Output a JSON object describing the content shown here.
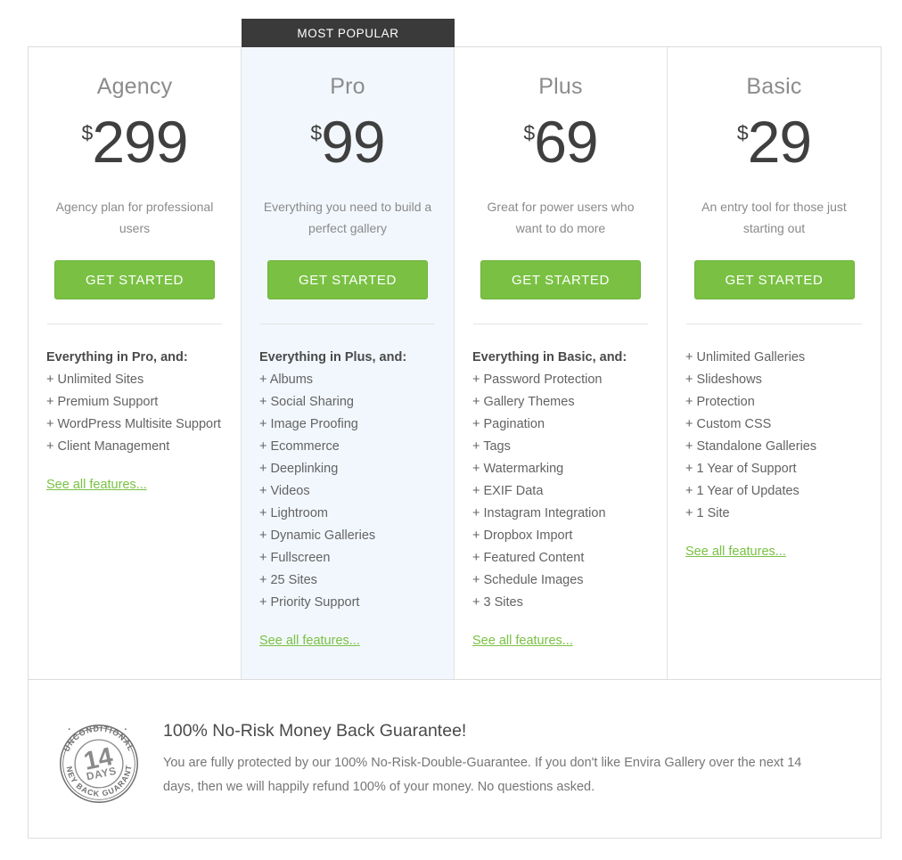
{
  "badge": {
    "label": "MOST POPULAR"
  },
  "colors": {
    "accent_green": "#7ac143",
    "featured_bg": "#f2f7fd",
    "ribbon_bg": "#3a3a3a"
  },
  "plans": [
    {
      "name": "Agency",
      "currency": "$",
      "price": "299",
      "tagline": "Agency plan for professional users",
      "cta": "GET STARTED",
      "features_head": "Everything in Pro, and:",
      "features": [
        "+ Unlimited Sites",
        "+ Premium Support",
        "+ WordPress Multisite Support",
        "+ Client Management"
      ],
      "see_all": "See all features...",
      "featured": false
    },
    {
      "name": "Pro",
      "currency": "$",
      "price": "99",
      "tagline": "Everything you need to build a perfect gallery",
      "cta": "GET STARTED",
      "features_head": "Everything in Plus, and:",
      "features": [
        "+ Albums",
        "+ Social Sharing",
        "+ Image Proofing",
        "+ Ecommerce",
        "+ Deeplinking",
        "+ Videos",
        "+ Lightroom",
        "+ Dynamic Galleries",
        "+ Fullscreen",
        "+ 25 Sites",
        "+ Priority Support"
      ],
      "see_all": "See all features...",
      "featured": true
    },
    {
      "name": "Plus",
      "currency": "$",
      "price": "69",
      "tagline": "Great for power users who want to do more",
      "cta": "GET STARTED",
      "features_head": "Everything in Basic, and:",
      "features": [
        "+ Password Protection",
        "+ Gallery Themes",
        "+ Pagination",
        "+ Tags",
        "+ Watermarking",
        "+ EXIF Data",
        "+ Instagram Integration",
        "+ Dropbox Import",
        "+ Featured Content",
        "+ Schedule Images",
        "+ 3 Sites"
      ],
      "see_all": "See all features...",
      "featured": false
    },
    {
      "name": "Basic",
      "currency": "$",
      "price": "29",
      "tagline": "An entry tool for those just starting out",
      "cta": "GET STARTED",
      "features_head": "",
      "features": [
        "+ Unlimited Galleries",
        "+ Slideshows",
        "+ Protection",
        "+ Custom CSS",
        "+ Standalone Galleries",
        "+ 1 Year of Support",
        "+ 1 Year of Updates",
        "+ 1 Site"
      ],
      "see_all": "See all features...",
      "featured": false
    }
  ],
  "guarantee": {
    "seal_outer_top": "UNCONDITIONAL",
    "seal_outer_bottom": "MONEY BACK GUARANTEE",
    "seal_number": "14",
    "seal_unit": "DAYS",
    "title": "100% No-Risk Money Back Guarantee!",
    "body": "You are fully protected by our 100% No-Risk-Double-Guarantee.  If you don't like Envira Gallery over the next 14 days, then we will happily refund 100% of your money. No questions asked."
  }
}
